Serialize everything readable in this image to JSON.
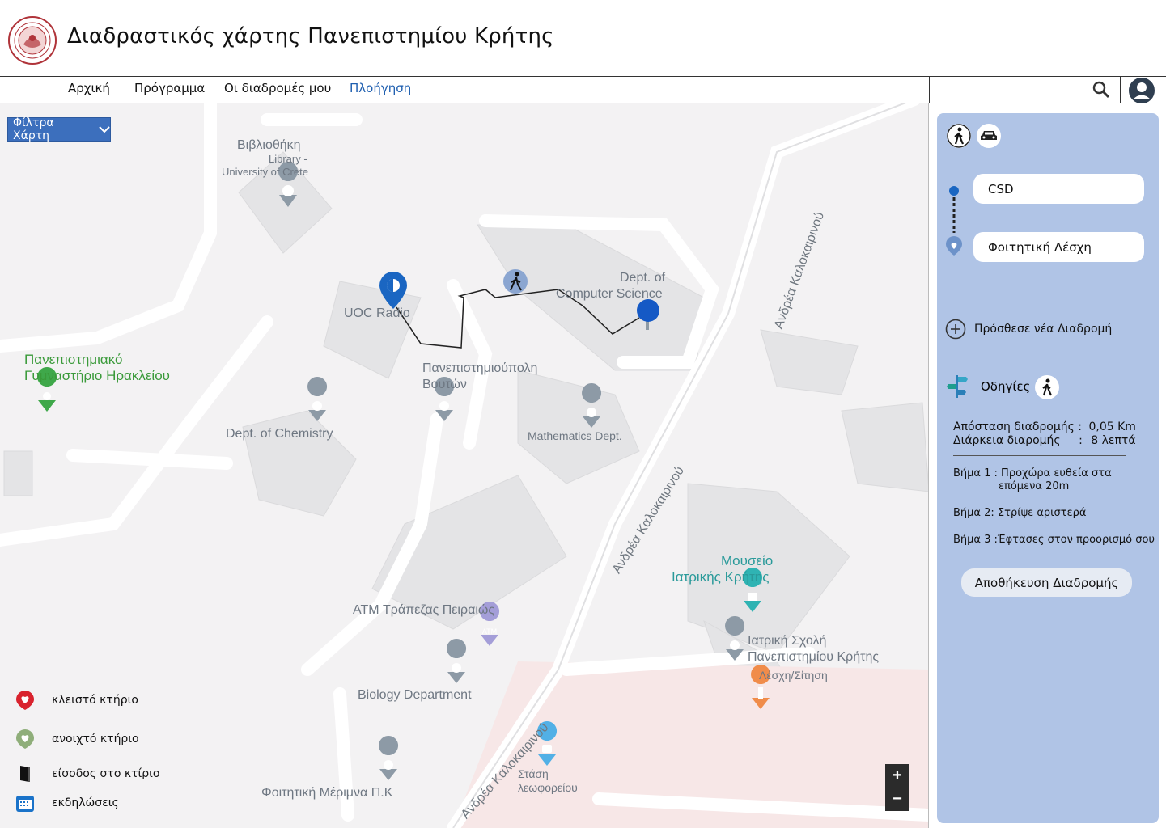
{
  "app": {
    "title": "Διαδραστικός χάρτης Πανεπιστημίου Κρήτης"
  },
  "nav": {
    "items": [
      {
        "label": "Αρχική"
      },
      {
        "label": "Πρόγραμμα"
      },
      {
        "label": "Οι διαδρομές μου"
      },
      {
        "label": "Πλοήγηση"
      }
    ],
    "active": "Πλοήγηση"
  },
  "search": {
    "value": ""
  },
  "map": {
    "filter_label": "Φίλτρα Χάρτη",
    "labels": {
      "library_el": "Βιβλιοθήκη",
      "library_en_1": "Library -",
      "library_en_2": "University of Crete",
      "uoc_radio": "UOC Radio",
      "csd_1": "Dept. of",
      "csd_2": "Computer Science",
      "gym_1": "Πανεπιστημιακό",
      "gym_2": "Γυμναστήριο Ηρακλείου",
      "campus_1": "Πανεπιστημιούπολη",
      "campus_2": "Βουτών",
      "chemistry": "Dept. of Chemistry",
      "math": "Mathematics Dept.",
      "museum_1": "Μουσείο",
      "museum_2": "Ιατρικής Κρήτης",
      "atm": "ATM Τράπεζας Πειραιώς",
      "medical_1": "Ιατρική Σχολή",
      "medical_2": "Πανεπιστημίου Κρήτης",
      "club": "Λέσχη/Σίτηση",
      "biology": "Biology Department",
      "bus_1": "Στάση",
      "bus_2": "λεωφορείου",
      "welfare": "Φοιτητική Μέριμνα Π.Κ",
      "road_1": "Ανδρέα Καλοκαιρινού",
      "road_2": "Ανδρέα Καλοκαιρινού",
      "road_3": "Ανδρέα Καλοκαιρινού"
    },
    "legend": [
      {
        "label": "κλειστό κτήριο",
        "icon": "closed-building-icon",
        "color": "#d9232e"
      },
      {
        "label": "ανοιχτό κτήριο",
        "icon": "open-building-icon",
        "color": "#8fae7a"
      },
      {
        "label": "είσοδος στο κτίριο",
        "icon": "door-icon",
        "color": "#111111"
      },
      {
        "label": "εκδηλώσεις",
        "icon": "calendar-icon",
        "color": "#1a73c9"
      }
    ],
    "zoom": {
      "in": "+",
      "out": "−"
    }
  },
  "panel": {
    "modes": [
      "walk-icon",
      "car-icon"
    ],
    "from": "CSD",
    "to": "Φοιτητική Λέσχη",
    "add_route": "Πρόσθεσε νέα Διαδρομή",
    "directions_title": "Οδηγίες",
    "distance_label": "Απόσταση διαδρομής :",
    "distance_value": "0,05 Km",
    "duration_label": "Διάρκεια διαρομής",
    "duration_sep": ":",
    "duration_value": "8 λεπτά",
    "step1_a": "Βήμα 1 : Προχώρα ευθεία στα",
    "step1_b": "επόμενα 20m",
    "step2": "Βήμα 2: Στρίψε αριστερά",
    "step3": "Βήμα 3 :Έφτασες στον προορισμό σου",
    "save": "Αποθήκευση Διαδρομής"
  },
  "colors": {
    "accent": "#3c6fbd",
    "panel": "#b0c4e6",
    "pin": "#1a66c2"
  }
}
